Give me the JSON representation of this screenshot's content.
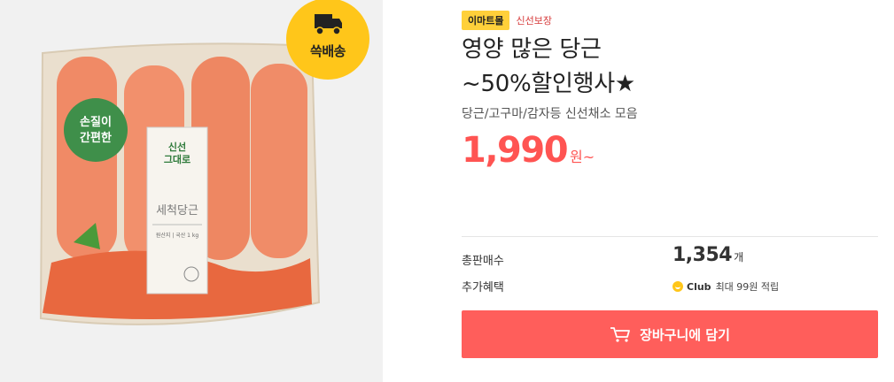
{
  "image": {
    "alt": "당근 상품 이미지",
    "badge_label": "쓱배송",
    "package_text": {
      "round_label": "손질이 간편한",
      "brand": "신선 그대로",
      "product_name": "세척당근",
      "origin": "원산지 | 국산   1 kg"
    }
  },
  "product": {
    "store_tag": "이마트몰",
    "fresh_tag": "신선보장",
    "title_line1": "영양 많은 당근",
    "title_line2": "~50%할인행사★",
    "subtitle": "당근/고구마/감자등 신선채소 모음",
    "price": "1,990",
    "price_unit": "원~"
  },
  "details": {
    "sales_label": "총판매수",
    "sales_count": "1,354",
    "sales_unit": "개",
    "benefit_label": "추가혜택",
    "club_name": "Club",
    "club_text": "최대 99원 적립"
  },
  "actions": {
    "cart_label": "장바구니에 담기"
  },
  "colors": {
    "accent": "#ff5e5b",
    "badge": "#ffc61a",
    "store_tag": "#ffd03a"
  }
}
